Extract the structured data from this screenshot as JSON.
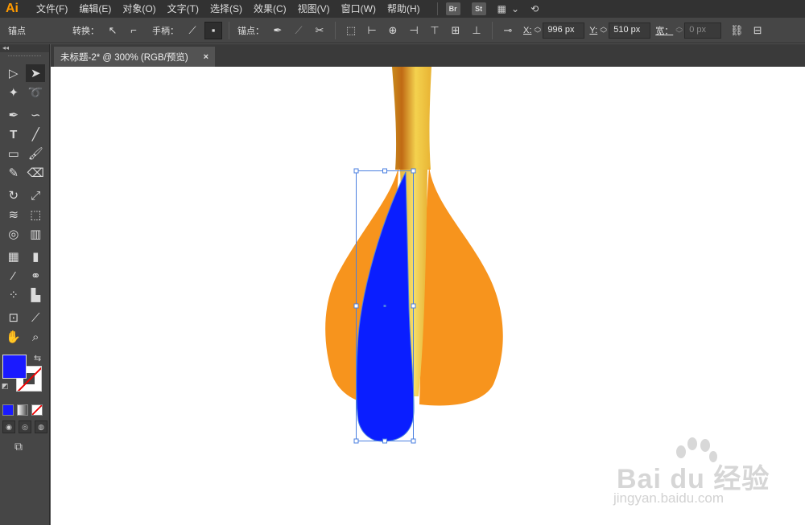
{
  "app": {
    "logo": "Ai"
  },
  "menubar": {
    "items": [
      "文件(F)",
      "编辑(E)",
      "对象(O)",
      "文字(T)",
      "选择(S)",
      "效果(C)",
      "视图(V)",
      "窗口(W)",
      "帮助(H)"
    ],
    "bridge_label": "Br",
    "stock_label": "St",
    "icons": [
      "workspace-switcher-icon",
      "chevron-down-icon",
      "sync-icon"
    ]
  },
  "controlbar": {
    "anchor_label": "锚点",
    "convert_label": "转换：",
    "handle_label": "手柄：",
    "anchors_label": "锚点：",
    "x_label": "X:",
    "x_value": "996 px",
    "y_label": "Y:",
    "y_value": "510 px",
    "width_label": "宽：",
    "width_value": "0 px"
  },
  "document": {
    "tab_title": "未标题-2* @ 300% (RGB/预览)",
    "close_glyph": "×"
  },
  "swatches": {
    "fill_color": "#1a1aff",
    "stroke": "none"
  },
  "artwork": {
    "shaft_colors": [
      "#c98a1c",
      "#f4d24e",
      "#e8b334"
    ],
    "fin_color": "#f7941d",
    "selected_shape_color": "#0a1eff",
    "selection_color": "#4a7fe0"
  },
  "watermark": {
    "brand": "Bai du 经验",
    "url": "jingyan.baidu.com"
  }
}
